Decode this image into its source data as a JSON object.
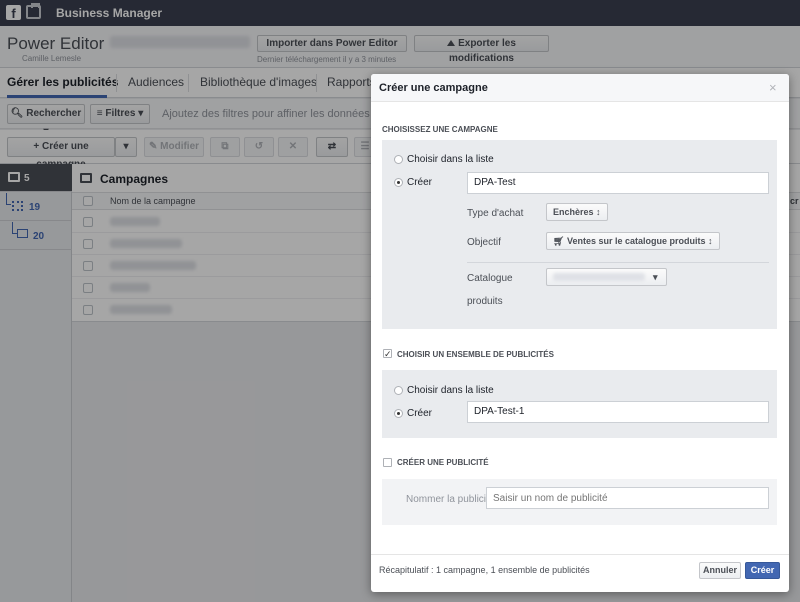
{
  "topbar": {
    "title": "Business Manager",
    "fb_glyph": "f"
  },
  "header": {
    "app_title": "Power Editor",
    "user_name": "Camille Lemesle",
    "import_label": "Importer dans Power Editor",
    "export_label": "Exporter les modifications",
    "last_download": "Dernier téléchargement il y a 3 minutes"
  },
  "tabs": [
    {
      "label": "Gérer les publicités"
    },
    {
      "label": "Audiences"
    },
    {
      "label": "Bibliothèque d'images"
    },
    {
      "label": "Rapports"
    }
  ],
  "toolbar": {
    "search_label": "Rechercher",
    "filters_label": "Filtres",
    "filter_hint": "Ajoutez des filtres pour affiner les données affi",
    "create_campaign_label": "Créer une campagne",
    "modify_label": "Modifier"
  },
  "sidebar": {
    "items": [
      {
        "count": "5"
      },
      {
        "count": "19"
      },
      {
        "count": "20"
      }
    ]
  },
  "table": {
    "title": "Campagnes",
    "col_name": "Nom de la campagne",
    "col_cut": "cr"
  },
  "modal": {
    "title": "Créer une campagne",
    "close_glyph": "×",
    "campaign_section": "Choisissez une campagne",
    "choose_list": "Choisir dans la liste",
    "create": "Créer",
    "campaign_name": "DPA-Test",
    "buy_type_label": "Type d'achat",
    "buy_type_value": "Enchères",
    "objective_label": "Objectif",
    "objective_value": "Ventes sur le catalogue produits",
    "catalog_label_1": "Catalogue",
    "catalog_label_2": "produits",
    "adset_section": "Choisir un ensemble de publicités",
    "adset_choose_list": "Choisir dans la liste",
    "adset_create": "Créer",
    "adset_name": "DPA-Test-1",
    "ad_section": "Créer une publicité",
    "ad_name_label": "Nommer la publicité",
    "ad_name_placeholder": "Saisir un nom de publicité",
    "recap": "Récapitulatif : 1 campagne, 1 ensemble de publicités",
    "cancel_label": "Annuler",
    "create_label": "Créer"
  }
}
